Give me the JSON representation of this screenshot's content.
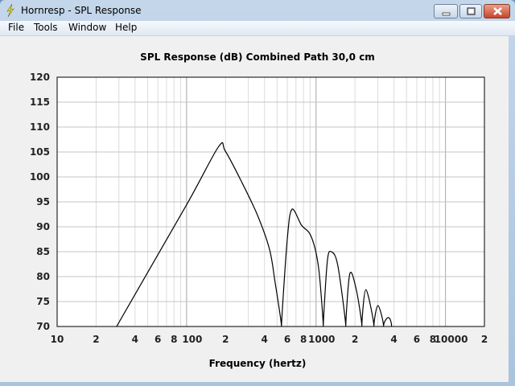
{
  "window": {
    "title": "Hornresp - SPL Response",
    "controls": [
      "minimize-icon",
      "maximize-icon",
      "close-icon"
    ]
  },
  "menu": [
    {
      "label": "File"
    },
    {
      "label": "Tools"
    },
    {
      "label": "Window"
    },
    {
      "label": "Help"
    }
  ],
  "chart_data": {
    "type": "line",
    "title": "SPL Response (dB)   Combined   Path 30,0 cm",
    "xlabel": "Frequency (hertz)",
    "ylabel": "",
    "xscale": "log",
    "xlim": [
      10,
      20000
    ],
    "ylim": [
      70,
      120
    ],
    "grid": true,
    "x_tick_labels": [
      "10",
      "2",
      "4",
      "6",
      "8",
      "100",
      "2",
      "4",
      "6",
      "8",
      "1000",
      "2",
      "4",
      "6",
      "8",
      "10000",
      "2"
    ],
    "x_tick_values": [
      10,
      20,
      40,
      60,
      80,
      100,
      200,
      400,
      600,
      800,
      1000,
      2000,
      4000,
      6000,
      8000,
      10000,
      20000
    ],
    "y_ticks": [
      70,
      75,
      80,
      85,
      90,
      95,
      100,
      105,
      110,
      115,
      120
    ],
    "line_color": "#000000",
    "series": [
      {
        "x": [
          28.8,
          100,
          177,
          199,
          264,
          352,
          437,
          482,
          541,
          598,
          651,
          773,
          891,
          986,
          1060,
          1138,
          1223,
          1313,
          1472,
          1698,
          1825,
          2046,
          2261,
          2428,
          2800,
          3008,
          3324,
          3623,
          3838
        ],
        "y": [
          70,
          94.4,
          106.1,
          105.2,
          99.2,
          92.4,
          85.5,
          79,
          70,
          87.1,
          93.5,
          90.3,
          88.7,
          85.5,
          80.6,
          70,
          83.1,
          85,
          82.3,
          70,
          80.6,
          77.4,
          70,
          77.4,
          70,
          74.2,
          70,
          71.8,
          70
        ]
      }
    ]
  }
}
